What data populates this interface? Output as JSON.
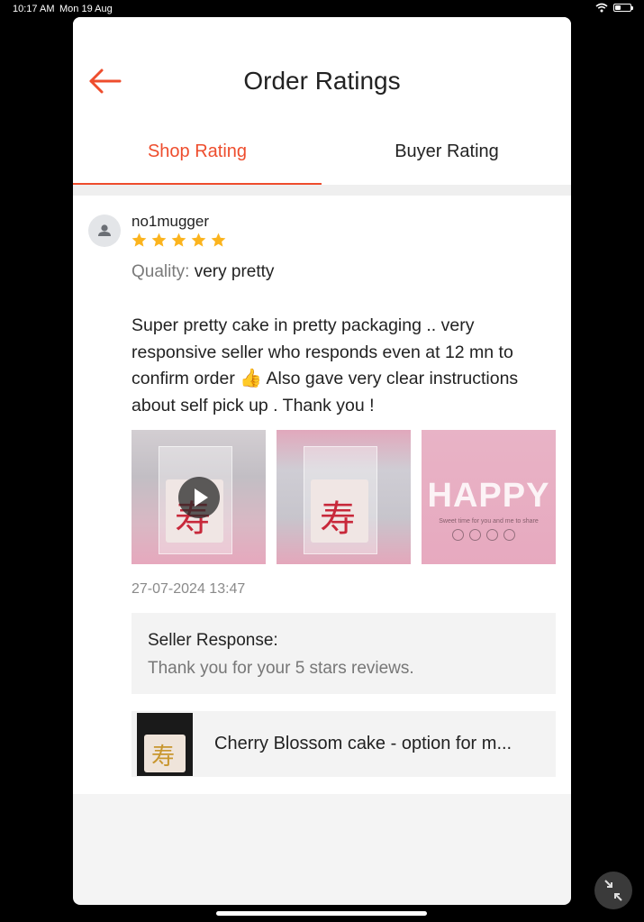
{
  "status_bar": {
    "time": "10:17 AM",
    "date": "Mon 19 Aug",
    "battery_level": 0.4
  },
  "header": {
    "title": "Order Ratings"
  },
  "tabs": [
    {
      "label": "Shop Rating",
      "active": true
    },
    {
      "label": "Buyer Rating",
      "active": false
    }
  ],
  "review": {
    "username": "no1mugger",
    "stars": 5,
    "quality_label": "Quality:",
    "quality_value": "very pretty",
    "comment_before": "Super pretty cake in pretty packaging .. very responsive seller who responds even at 12 mn to confirm order",
    "comment_emoji": "👍",
    "comment_after": "Also gave very clear instructions about self pick up . Thank you !",
    "media": [
      {
        "type": "video",
        "icon": "play-icon"
      },
      {
        "type": "image"
      },
      {
        "type": "image",
        "overlay_text": "HAPPY",
        "sub_text": "Sweet time for you and me to share"
      }
    ],
    "timestamp": "27-07-2024 13:47",
    "seller_response": {
      "title": "Seller Response:",
      "text": "Thank you for your 5 stars reviews."
    },
    "product": {
      "name": "Cherry Blossom cake - option for m..."
    }
  },
  "colors": {
    "accent": "#ee4d2d",
    "star": "#fbb41e",
    "muted_text": "#8a8a8a",
    "response_bg": "#f3f3f3"
  }
}
